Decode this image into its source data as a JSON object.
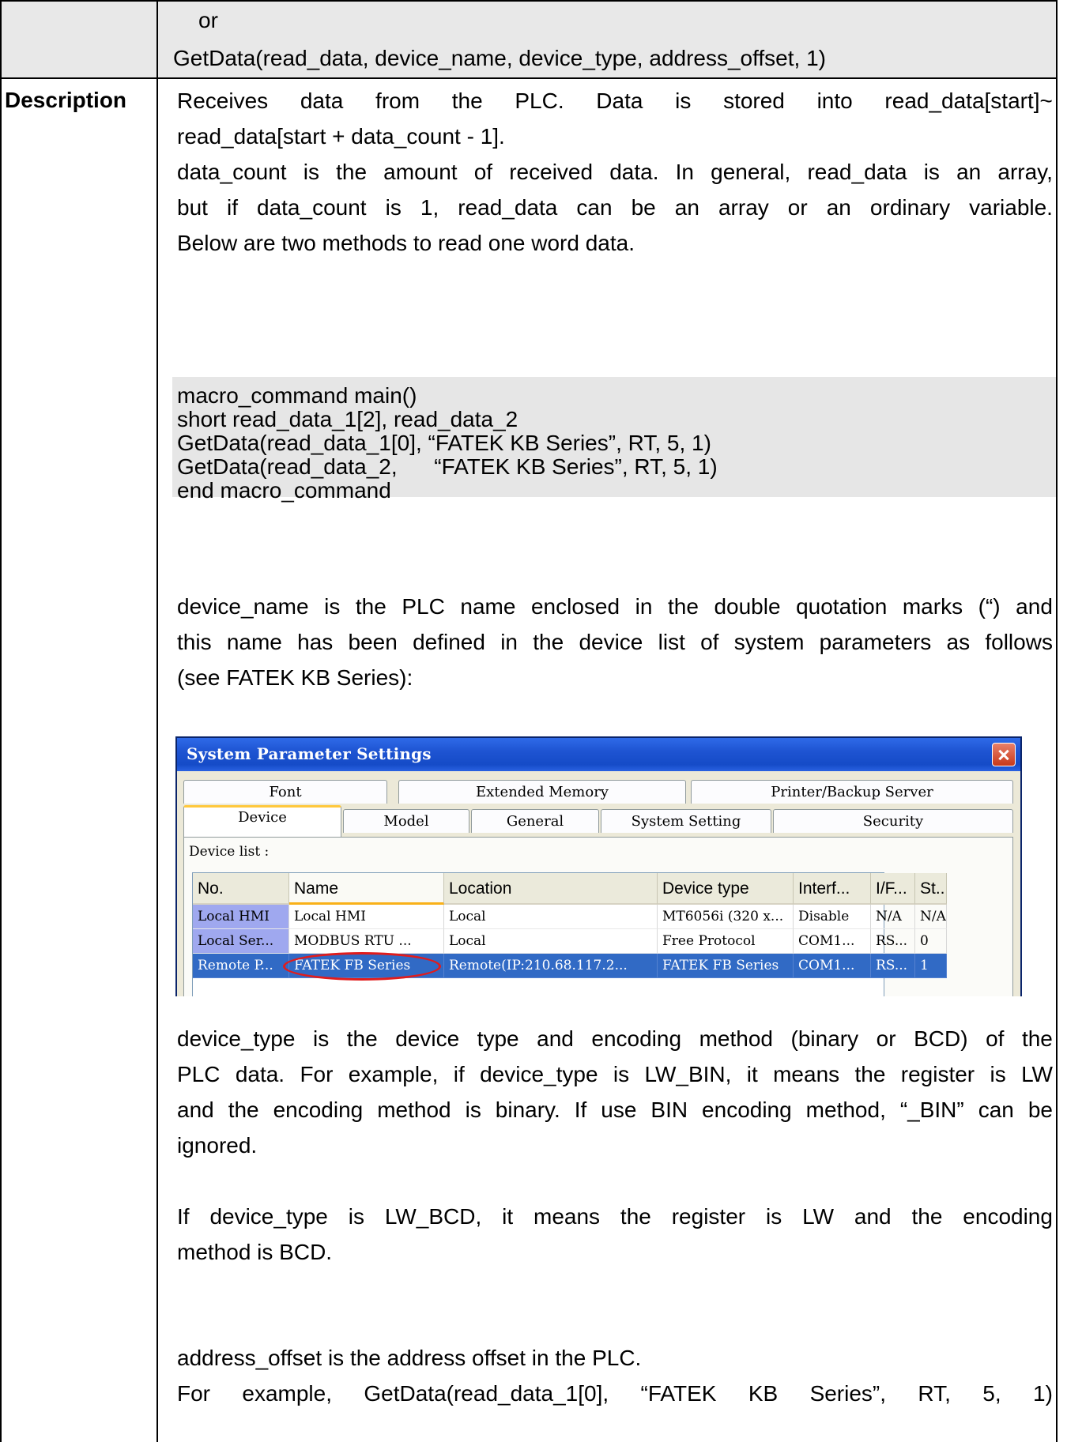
{
  "row_top": {
    "or_text": "or",
    "getdata_alt": "GetData(read_data, device_name, device_type, address_offset, 1)"
  },
  "description": {
    "label": "Description",
    "para1": [
      [
        "Receives",
        "data",
        "from",
        "the",
        "PLC.",
        "Data",
        "is",
        "stored",
        "into",
        "read_data[start]~"
      ],
      [
        "read_data[start + data_count - 1]."
      ]
    ],
    "para2": [
      [
        "data_count",
        "is",
        "the",
        "amount",
        "of",
        "received",
        "data.",
        "In",
        "general,",
        "read_data",
        "is",
        "an",
        "array,"
      ],
      [
        "but",
        "if",
        "data_count",
        "is",
        "1,",
        "read_data",
        "can",
        "be",
        "an",
        "array",
        "or",
        "an",
        "ordinary",
        "variable."
      ],
      [
        "Below are two methods to read one word data."
      ]
    ],
    "code": [
      "macro_command main()",
      "short read_data_1[2], read_data_2",
      "GetData(read_data_1[0], “FATEK KB Series”, RT, 5, 1)",
      "GetData(read_data_2,      “FATEK KB Series”, RT, 5, 1)",
      "end macro_command"
    ],
    "para3": [
      [
        "device_name",
        "is",
        "the",
        "PLC",
        "name",
        "enclosed",
        "in",
        "the",
        "double",
        "quotation",
        "marks",
        "(“)",
        "and"
      ],
      [
        "this",
        "name",
        "has",
        "been",
        "defined",
        "in",
        "the",
        "device",
        "list",
        "of",
        "system",
        "parameters",
        "as",
        "follows"
      ],
      [
        "(see FATEK KB Series):"
      ]
    ],
    "para4": [
      [
        "device_type",
        "is",
        "the",
        "device",
        "type",
        "and",
        "encoding",
        "method",
        "(binary",
        "or",
        "BCD)",
        "of",
        "the"
      ],
      [
        "PLC",
        "data.",
        "For",
        "example,",
        "if",
        "device_type",
        "is",
        "LW_BIN,",
        "it",
        "means",
        "the",
        "register",
        "is",
        "LW"
      ],
      [
        "and",
        "the",
        "encoding",
        "method",
        "is",
        "binary.",
        "If",
        "use",
        "BIN",
        "encoding",
        "method,",
        "“_BIN”",
        "can",
        "be"
      ],
      [
        "ignored."
      ]
    ],
    "para5": [
      [
        "If",
        "device_type",
        "is",
        "LW_BCD,",
        "it",
        "means",
        "the",
        "register",
        "is",
        "LW",
        "and",
        "the",
        "encoding"
      ],
      [
        "method is BCD."
      ]
    ],
    "para6": [
      [
        "address_offset is the address offset in the PLC."
      ],
      [
        "For",
        "example,",
        "GetData(read_data_1[0],",
        "“FATEK",
        "KB",
        "Series”,",
        "RT,",
        "5,",
        "1)"
      ]
    ]
  },
  "dialog": {
    "title": "System Parameter Settings",
    "tabs_back": [
      "Font",
      "Extended Memory",
      "Printer/Backup Server"
    ],
    "tabs_front": [
      "Device",
      "Model",
      "General",
      "System Setting",
      "Security"
    ],
    "device_list_label": "Device list :",
    "columns": [
      "No.",
      "Name",
      "Location",
      "Device type",
      "Interf...",
      "I/F...",
      "St..."
    ],
    "rows": [
      [
        "Local HMI",
        "Local HMI",
        "Local",
        "MT6056i (320 x...",
        "Disable",
        "N/A",
        "N/A"
      ],
      [
        "Local Ser...",
        "MODBUS RTU ...",
        "Local",
        "Free Protocol",
        "COM1...",
        "RS...",
        "0"
      ],
      [
        "Remote P...",
        "FATEK FB Series",
        "Remote(IP:210.68.117.2...",
        "FATEK FB Series",
        "COM1...",
        "RS...",
        "1"
      ]
    ],
    "highlight_color": "#e11c1c",
    "selected_row_color": "#316ac5"
  }
}
